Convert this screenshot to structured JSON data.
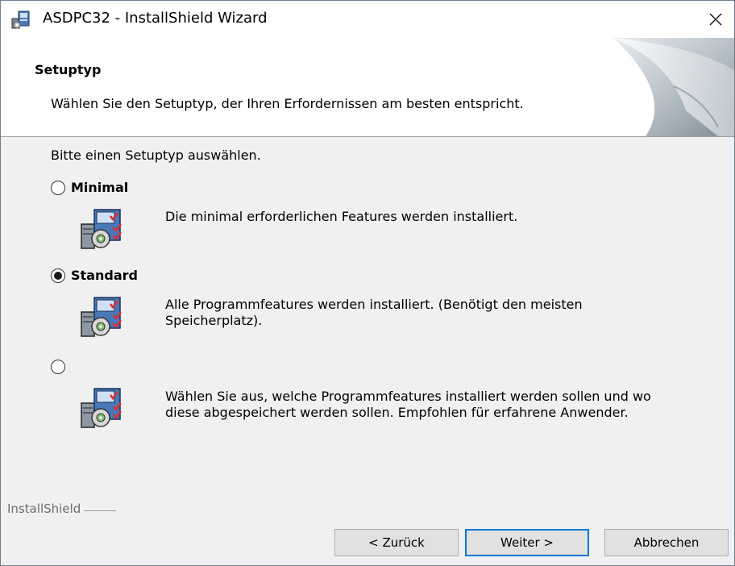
{
  "window": {
    "title": "ASDPC32 - InstallShield Wizard",
    "close_glyph": "✕"
  },
  "header": {
    "title": "Setuptyp",
    "subtitle": "Wählen Sie den Setuptyp, der Ihren Erfordernissen am besten entspricht."
  },
  "body": {
    "prompt": "Bitte einen Setuptyp auswählen.",
    "options": [
      {
        "label": "Minimal",
        "selected": false,
        "description": "Die minimal erforderlichen Features werden installiert.",
        "icon": "setup-package-icon"
      },
      {
        "label": "Standard",
        "selected": true,
        "description": "Alle Programmfeatures werden installiert. (Benötigt den meisten Speicherplatz).",
        "icon": "setup-package-icon"
      },
      {
        "label": "",
        "selected": false,
        "description": "Wählen Sie aus, welche Programmfeatures installiert werden sollen und wo diese abgespeichert werden sollen. Empfohlen für erfahrene Anwender.",
        "icon": "setup-package-icon"
      }
    ]
  },
  "footer": {
    "brand": "InstallShield",
    "back_label": "< Zurück",
    "next_label": "Weiter >",
    "cancel_label": "Abbrechen"
  },
  "colors": {
    "accent": "#0078d7",
    "dialog_bg": "#f0f0f0",
    "header_bg": "#ffffff"
  }
}
